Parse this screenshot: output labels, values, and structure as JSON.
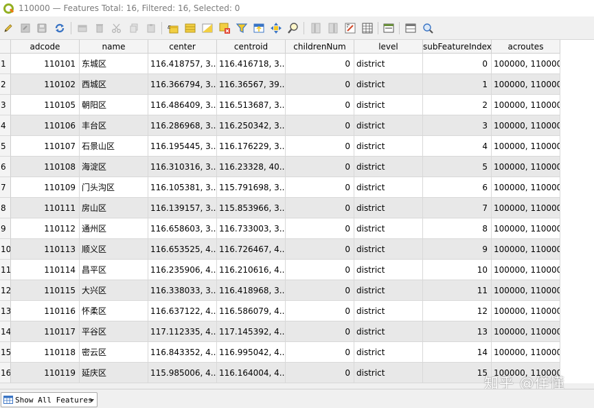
{
  "window": {
    "title": "110000 — Features Total: 16, Filtered: 16, Selected: 0"
  },
  "toolbar": {
    "icons": [
      "edit-pencil-icon",
      "multi-edit-icon",
      "save-edits-icon",
      "reload-icon",
      "add-feature-icon",
      "delete-feature-icon",
      "cut-icon",
      "copy-icon",
      "paste-icon",
      "expression-select-icon",
      "select-all-icon",
      "invert-selection-icon",
      "deselect-icon",
      "filter-select-icon",
      "move-selection-top-icon",
      "pan-to-selection-icon",
      "zoom-to-selection-icon",
      "new-field-icon",
      "delete-field-icon",
      "field-calculator-icon",
      "conditional-format-icon",
      "dock-icon",
      "form-view-icon",
      "table-view-icon"
    ]
  },
  "table": {
    "columns": [
      "adcode",
      "name",
      "center",
      "centroid",
      "childrenNum",
      "level",
      "subFeatureIndex",
      "acroutes"
    ],
    "rows": [
      {
        "num": "1",
        "adcode": "110101",
        "name": "东城区",
        "center": "116.418757, 3...",
        "centroid": "116.416718, 3...",
        "childrenNum": "0",
        "level": "district",
        "subFeatureIndex": "0",
        "acroutes": "100000, 110000"
      },
      {
        "num": "2",
        "adcode": "110102",
        "name": "西城区",
        "center": "116.366794, 3...",
        "centroid": "116.36567, 39...",
        "childrenNum": "0",
        "level": "district",
        "subFeatureIndex": "1",
        "acroutes": "100000, 110000"
      },
      {
        "num": "3",
        "adcode": "110105",
        "name": "朝阳区",
        "center": "116.486409, 3...",
        "centroid": "116.513687, 3...",
        "childrenNum": "0",
        "level": "district",
        "subFeatureIndex": "2",
        "acroutes": "100000, 110000"
      },
      {
        "num": "4",
        "adcode": "110106",
        "name": "丰台区",
        "center": "116.286968, 3...",
        "centroid": "116.250342, 3...",
        "childrenNum": "0",
        "level": "district",
        "subFeatureIndex": "3",
        "acroutes": "100000, 110000"
      },
      {
        "num": "5",
        "adcode": "110107",
        "name": "石景山区",
        "center": "116.195445, 3...",
        "centroid": "116.176229, 3...",
        "childrenNum": "0",
        "level": "district",
        "subFeatureIndex": "4",
        "acroutes": "100000, 110000"
      },
      {
        "num": "6",
        "adcode": "110108",
        "name": "海淀区",
        "center": "116.310316, 3...",
        "centroid": "116.23328, 40...",
        "childrenNum": "0",
        "level": "district",
        "subFeatureIndex": "5",
        "acroutes": "100000, 110000"
      },
      {
        "num": "7",
        "adcode": "110109",
        "name": "门头沟区",
        "center": "116.105381, 3...",
        "centroid": "115.791698, 3...",
        "childrenNum": "0",
        "level": "district",
        "subFeatureIndex": "6",
        "acroutes": "100000, 110000"
      },
      {
        "num": "8",
        "adcode": "110111",
        "name": "房山区",
        "center": "116.139157, 3...",
        "centroid": "115.853966, 3...",
        "childrenNum": "0",
        "level": "district",
        "subFeatureIndex": "7",
        "acroutes": "100000, 110000"
      },
      {
        "num": "9",
        "adcode": "110112",
        "name": "通州区",
        "center": "116.658603, 3...",
        "centroid": "116.733003, 3...",
        "childrenNum": "0",
        "level": "district",
        "subFeatureIndex": "8",
        "acroutes": "100000, 110000"
      },
      {
        "num": "10",
        "adcode": "110113",
        "name": "顺义区",
        "center": "116.653525, 4...",
        "centroid": "116.726467, 4...",
        "childrenNum": "0",
        "level": "district",
        "subFeatureIndex": "9",
        "acroutes": "100000, 110000"
      },
      {
        "num": "11",
        "adcode": "110114",
        "name": "昌平区",
        "center": "116.235906, 4...",
        "centroid": "116.210616, 4...",
        "childrenNum": "0",
        "level": "district",
        "subFeatureIndex": "10",
        "acroutes": "100000, 110000"
      },
      {
        "num": "12",
        "adcode": "110115",
        "name": "大兴区",
        "center": "116.338033, 3...",
        "centroid": "116.418968, 3...",
        "childrenNum": "0",
        "level": "district",
        "subFeatureIndex": "11",
        "acroutes": "100000, 110000"
      },
      {
        "num": "13",
        "adcode": "110116",
        "name": "怀柔区",
        "center": "116.637122, 4...",
        "centroid": "116.586079, 4...",
        "childrenNum": "0",
        "level": "district",
        "subFeatureIndex": "12",
        "acroutes": "100000, 110000"
      },
      {
        "num": "14",
        "adcode": "110117",
        "name": "平谷区",
        "center": "117.112335, 4...",
        "centroid": "117.145392, 4...",
        "childrenNum": "0",
        "level": "district",
        "subFeatureIndex": "13",
        "acroutes": "100000, 110000"
      },
      {
        "num": "15",
        "adcode": "110118",
        "name": "密云区",
        "center": "116.843352, 4...",
        "centroid": "116.995042, 4...",
        "childrenNum": "0",
        "level": "district",
        "subFeatureIndex": "14",
        "acroutes": "100000, 110000"
      },
      {
        "num": "16",
        "adcode": "110119",
        "name": "延庆区",
        "center": "115.985006, 4...",
        "centroid": "116.164004, 4...",
        "childrenNum": "0",
        "level": "district",
        "subFeatureIndex": "15",
        "acroutes": "100000, 110000"
      }
    ]
  },
  "statusbar": {
    "filter_label": "Show All Features"
  },
  "watermark": {
    "text": "知乎 @佯懂"
  },
  "colors": {
    "accent": "#93b023",
    "row_alt": "#e8e8e8",
    "header_bg": "#f4f4f4"
  }
}
